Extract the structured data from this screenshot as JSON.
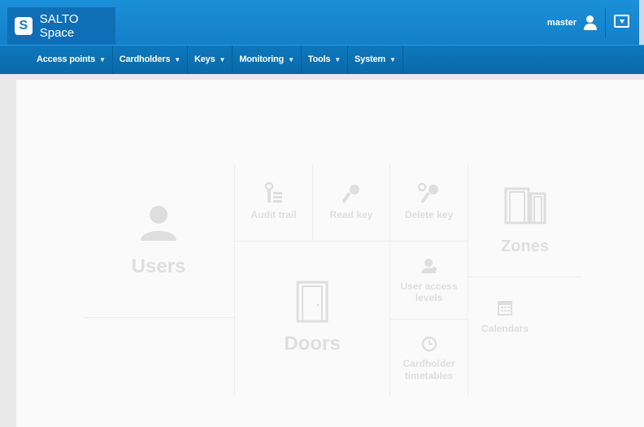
{
  "app": {
    "brand_logo": "S",
    "brand_name": "SALTO Space"
  },
  "header": {
    "user_name": "master",
    "icons": [
      "user-icon",
      "logout-icon"
    ]
  },
  "menu": [
    {
      "label": "Access points"
    },
    {
      "label": "Cardholders"
    },
    {
      "label": "Keys"
    },
    {
      "label": "Monitoring"
    },
    {
      "label": "Tools"
    },
    {
      "label": "System"
    }
  ],
  "tiles": {
    "users": "Users",
    "audit_trail": "Audit trail",
    "read_key": "Read key",
    "delete_key": "Delete key",
    "zones": "Zones",
    "doors": "Doors",
    "user_access_levels": "User access levels",
    "calendars": "Calendars",
    "cardholder_timetables": "Cardholder timetables"
  },
  "colors": {
    "header": "#1380c8",
    "menubar": "#0a69a8",
    "tile_text": "#dedede"
  }
}
